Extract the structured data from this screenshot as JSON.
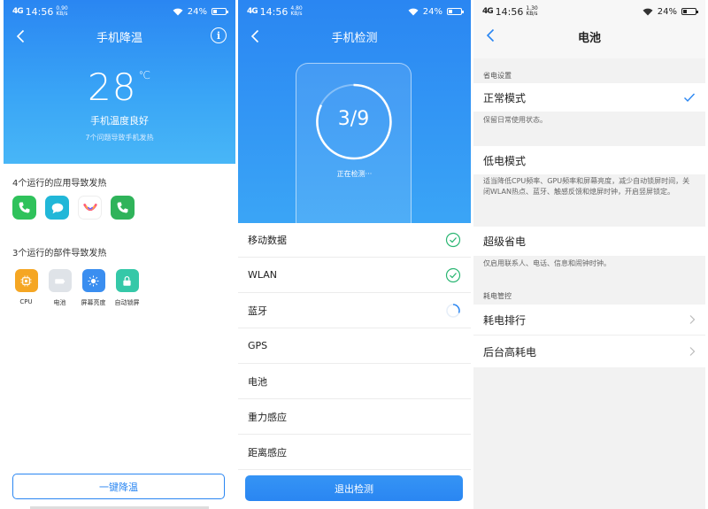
{
  "status_bars": [
    {
      "signal": "4G",
      "time": "14:56",
      "speed": "0.90 KB/s",
      "battery": "24%"
    },
    {
      "signal": "4G",
      "time": "14:56",
      "speed": "4.80 KB/s",
      "battery": "24%"
    },
    {
      "signal": "4G",
      "time": "14:56",
      "speed": "1.30 KB/s",
      "battery": "24%"
    }
  ],
  "cooling": {
    "title": "手机降温",
    "temperature": "28",
    "unit": "℃",
    "status": "手机温度良好",
    "sub": "7个问题导致手机发热",
    "apps_title": "4个运行的应用导致发热",
    "apps": [
      "phone-icon",
      "message-icon",
      "jovi-icon",
      "phone-icon"
    ],
    "parts_title": "3个运行的部件导致发热",
    "parts": [
      {
        "label": "CPU",
        "icon": "cpu-icon",
        "color": "#f5a623"
      },
      {
        "label": "电池",
        "icon": "battery-icon",
        "color": "#dfe3e8"
      },
      {
        "label": "屏幕亮度",
        "icon": "brightness-icon",
        "color": "#3a8ef0"
      },
      {
        "label": "自动锁屏",
        "icon": "lock-icon",
        "color": "#35c8a8"
      }
    ],
    "button": "一键降温"
  },
  "check": {
    "title": "手机检测",
    "progress": "3/9",
    "status": "正在检测···",
    "items": [
      {
        "label": "移动数据",
        "state": "done"
      },
      {
        "label": "WLAN",
        "state": "done"
      },
      {
        "label": "蓝牙",
        "state": "loading"
      },
      {
        "label": "GPS",
        "state": "pending"
      },
      {
        "label": "电池",
        "state": "pending"
      },
      {
        "label": "重力感应",
        "state": "pending"
      },
      {
        "label": "距离感应",
        "state": "pending"
      }
    ],
    "button": "退出检测"
  },
  "battery": {
    "title": "电池",
    "save_group": "省电设置",
    "modes": [
      {
        "label": "正常模式",
        "desc": "保留日常使用状态。",
        "selected": true
      },
      {
        "label": "低电模式",
        "desc": "适当降低CPU频率、GPU频率和屏幕亮度，减少自动锁屏时间，关闭WLAN热点、蓝牙、触感反馈和熄屏时钟，开启竖屏锁定。",
        "selected": false
      },
      {
        "label": "超级省电",
        "desc": "仅启用联系人、电话、信息和闹钟时钟。",
        "selected": false
      }
    ],
    "usage_group": "耗电管控",
    "usage_items": [
      "耗电排行",
      "后台高耗电"
    ]
  },
  "colors": {
    "accent": "#2a86f2",
    "check": "#2bb673"
  }
}
